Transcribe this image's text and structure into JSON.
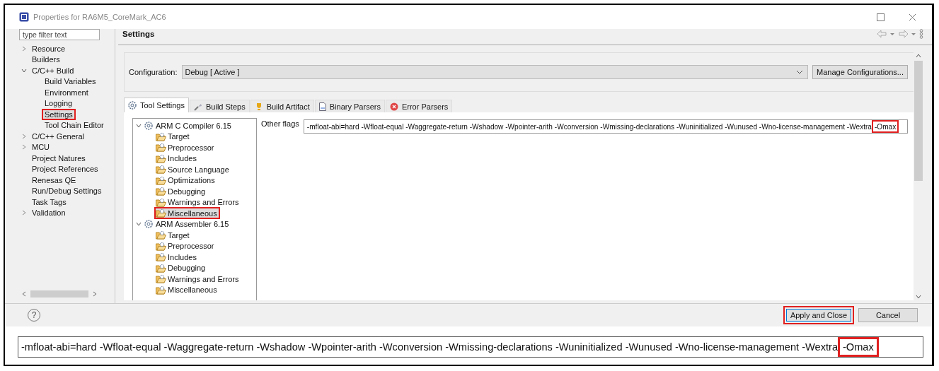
{
  "window": {
    "title": "Properties for RA6M5_CoreMark_AC6"
  },
  "filter": {
    "placeholder": "type filter text"
  },
  "sidebar": {
    "items": [
      {
        "label": "Resource",
        "expandable": true,
        "expanded": false,
        "highlighted": false
      },
      {
        "label": "Builders",
        "highlighted": false
      },
      {
        "label": "C/C++ Build",
        "expandable": true,
        "expanded": true,
        "highlighted": false,
        "children": [
          {
            "label": "Build Variables",
            "highlighted": false
          },
          {
            "label": "Environment",
            "highlighted": false
          },
          {
            "label": "Logging",
            "highlighted": false
          },
          {
            "label": "Settings",
            "highlighted": true
          },
          {
            "label": "Tool Chain Editor",
            "highlighted": false
          }
        ]
      },
      {
        "label": "C/C++ General",
        "expandable": true,
        "expanded": false,
        "highlighted": false
      },
      {
        "label": "MCU",
        "expandable": true,
        "expanded": false,
        "highlighted": false
      },
      {
        "label": "Project Natures",
        "highlighted": false
      },
      {
        "label": "Project References",
        "highlighted": false
      },
      {
        "label": "Renesas QE",
        "highlighted": false
      },
      {
        "label": "Run/Debug Settings",
        "highlighted": false
      },
      {
        "label": "Task Tags",
        "highlighted": false
      },
      {
        "label": "Validation",
        "expandable": true,
        "expanded": false,
        "highlighted": false
      }
    ]
  },
  "page": {
    "title": "Settings"
  },
  "configuration": {
    "label": "Configuration:",
    "value": "Debug  [ Active ]",
    "button": "Manage Configurations..."
  },
  "tabs": [
    {
      "label": "Tool Settings",
      "kind": "gear",
      "selected": true
    },
    {
      "label": "Build Steps",
      "kind": "steps",
      "selected": false
    },
    {
      "label": "Build Artifact",
      "kind": "trophy",
      "selected": false
    },
    {
      "label": "Binary Parsers",
      "kind": "binary",
      "selected": false
    },
    {
      "label": "Error Parsers",
      "kind": "error",
      "selected": false
    }
  ],
  "tool_tree": [
    {
      "label": "ARM C Compiler 6.15",
      "expanded": true,
      "highlighted": false,
      "children": [
        {
          "label": "Target",
          "highlighted": false
        },
        {
          "label": "Preprocessor",
          "highlighted": false
        },
        {
          "label": "Includes",
          "highlighted": false
        },
        {
          "label": "Source Language",
          "highlighted": false
        },
        {
          "label": "Optimizations",
          "highlighted": false
        },
        {
          "label": "Debugging",
          "highlighted": false
        },
        {
          "label": "Warnings and Errors",
          "highlighted": false
        },
        {
          "label": "Miscellaneous",
          "highlighted": true
        }
      ]
    },
    {
      "label": "ARM Assembler 6.15",
      "expanded": true,
      "highlighted": false,
      "children": [
        {
          "label": "Target",
          "highlighted": false
        },
        {
          "label": "Preprocessor",
          "highlighted": false
        },
        {
          "label": "Includes",
          "highlighted": false
        },
        {
          "label": "Debugging",
          "highlighted": false
        },
        {
          "label": "Warnings and Errors",
          "highlighted": false
        },
        {
          "label": "Miscellaneous",
          "highlighted": false
        }
      ]
    }
  ],
  "other_flags": {
    "label": "Other flags",
    "parts": [
      {
        "text": "-mfloat-abi=hard -Wfloat-equal -Waggregate-return -Wshadow -Wpointer-arith -Wconversion -Wmissing-declarations -Wuninitialized -Wunused -Wno-license-management -Wextra",
        "highlighted": false
      },
      {
        "text": "-Omax",
        "highlighted": true
      }
    ]
  },
  "footer": {
    "help": "?",
    "buttons": [
      {
        "label": "Apply and Close",
        "default": true,
        "highlighted": true
      },
      {
        "label": "Cancel",
        "default": false,
        "highlighted": false
      }
    ]
  },
  "zoomed_flags": {
    "parts": [
      {
        "text": "-mfloat-abi=hard -Wfloat-equal -Waggregate-return -Wshadow -Wpointer-arith -Wconversion -Wmissing-declarations -Wuninitialized -Wunused -Wno-license-management -Wextra",
        "highlighted": false
      },
      {
        "text": "-Omax",
        "highlighted": true
      }
    ]
  }
}
